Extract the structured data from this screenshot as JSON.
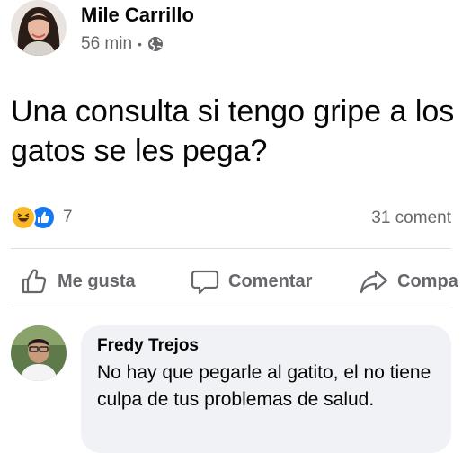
{
  "post": {
    "author": "Mile Carrillo",
    "time": "56 min",
    "separator": "•",
    "privacy_icon": "globe-icon",
    "text": "Una consulta si tengo gripe a los gatos se les pega?"
  },
  "reactions": {
    "icons": [
      "haha-reaction-icon",
      "like-reaction-icon"
    ],
    "count": "7",
    "comments": "31 coment"
  },
  "actions": {
    "like": "Me gusta",
    "comment": "Comentar",
    "share": "Compa"
  },
  "comment": {
    "author": "Fredy Trejos",
    "text": "No hay que pegarle al gatito, el no tiene culpa de tus problemas de salud."
  },
  "colors": {
    "secondary_text": "#65676b",
    "like_blue": "#1877f2",
    "haha_yellow": "#f7b928",
    "bubble_bg": "#f0f2f5"
  }
}
